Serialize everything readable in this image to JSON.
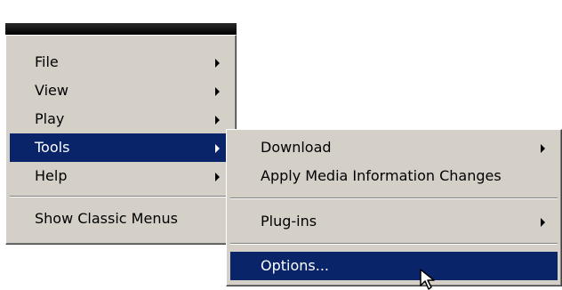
{
  "main_menu": {
    "items": [
      {
        "label": "File",
        "has_submenu": true
      },
      {
        "label": "View",
        "has_submenu": true
      },
      {
        "label": "Play",
        "has_submenu": true
      },
      {
        "label": "Tools",
        "has_submenu": true,
        "selected": true
      },
      {
        "label": "Help",
        "has_submenu": true
      },
      {
        "label": "Show Classic Menus",
        "has_submenu": false
      }
    ]
  },
  "tools_submenu": {
    "items": [
      {
        "label": "Download",
        "has_submenu": true
      },
      {
        "label": "Apply Media Information Changes",
        "has_submenu": false
      },
      {
        "label": "Plug-ins",
        "has_submenu": true
      },
      {
        "label": "Options...",
        "has_submenu": false,
        "selected": true
      }
    ]
  },
  "colors": {
    "menu_background": "#d4d0c8",
    "selection_background": "#0a246a",
    "selection_text": "#ffffff"
  },
  "icons": {
    "submenu_arrow": "triangle-right",
    "pointer": "arrow-cursor"
  }
}
